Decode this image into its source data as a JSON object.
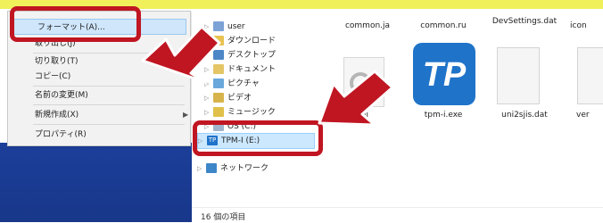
{
  "context_menu": {
    "items": [
      {
        "label": "フォーマット(A)..."
      },
      {
        "label": "取り出し(J)"
      },
      {
        "label": "切り取り(T)"
      },
      {
        "label": "コピー(C)"
      },
      {
        "label": "名前の変更(M)"
      },
      {
        "label": "新規作成(X)"
      },
      {
        "label": "プロパティ(R)"
      }
    ]
  },
  "nav": {
    "items": [
      {
        "label": "user",
        "icon": "user-folder-icon"
      },
      {
        "label": "ダウンロード",
        "icon": "downloads-folder-icon"
      },
      {
        "label": "デスクトップ",
        "icon": "desktop-folder-icon"
      },
      {
        "label": "ドキュメント",
        "icon": "documents-folder-icon"
      },
      {
        "label": "ピクチャ",
        "icon": "pictures-folder-icon"
      },
      {
        "label": "ビデオ",
        "icon": "videos-folder-icon"
      },
      {
        "label": "ミュージック",
        "icon": "music-folder-icon"
      },
      {
        "label": "OS (C:)",
        "icon": "drive-icon"
      },
      {
        "label": "TPM-I (E:)",
        "icon": "tpm-drive-icon"
      },
      {
        "label": "ネットワーク",
        "icon": "network-icon"
      }
    ]
  },
  "files": {
    "top_row": [
      "common.ja",
      "common.ru",
      "DevSettings.dat",
      "icon"
    ],
    "bottom_row": [
      "ss.ini",
      "tpm-i.exe",
      "uni2sjis.dat",
      "ver"
    ]
  },
  "status": {
    "count_text": "16 個の項目"
  },
  "colors": {
    "highlight": "#cfe6fb",
    "selection": "#cce8ff",
    "annotation_red": "#c01622",
    "tpm_blue": "#1f73c9"
  }
}
